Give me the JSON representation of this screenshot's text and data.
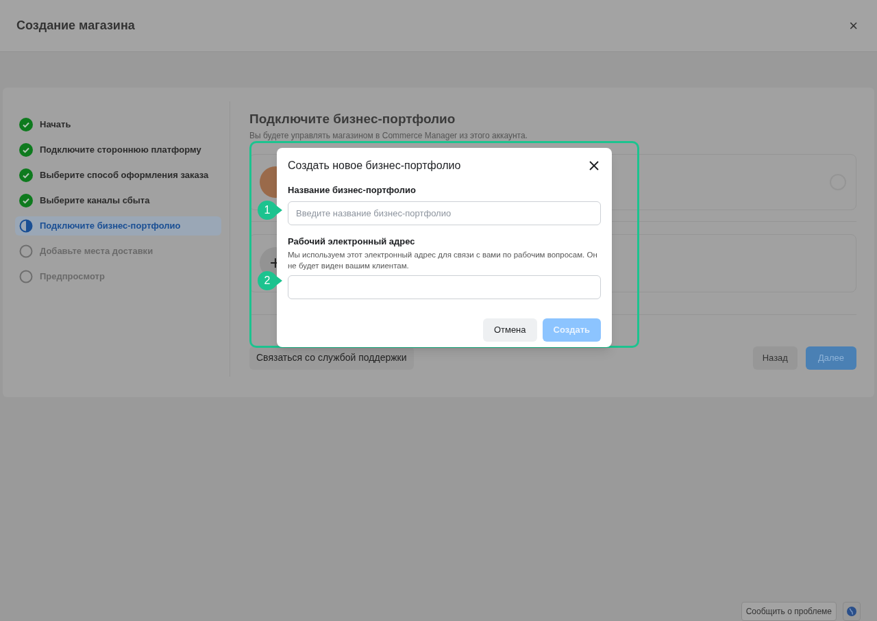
{
  "window": {
    "title": "Создание магазина",
    "close": "×"
  },
  "steps": [
    {
      "label": "Начать",
      "kind": "done",
      "selected": false
    },
    {
      "label": "Подключите стороннюю платформу",
      "kind": "done",
      "selected": false
    },
    {
      "label": "Выберите способ оформления заказа",
      "kind": "done",
      "selected": false
    },
    {
      "label": "Выберите каналы сбыта",
      "kind": "done",
      "selected": false
    },
    {
      "label": "Подключите бизнес-портфолио",
      "kind": "current",
      "selected": true
    },
    {
      "label": "Добавьте места доставки",
      "kind": "pending",
      "selected": false
    },
    {
      "label": "Предпросмотр",
      "kind": "pending",
      "selected": false
    }
  ],
  "main": {
    "title": "Подключите бизнес-портфолио",
    "subtitle": "Вы будете управлять магазином в Commerce Manager из этого аккаунта.",
    "account_selected": false,
    "add_symbol": "+",
    "support_button": "Связаться со службой поддержки",
    "back_button": "Назад",
    "next_button": "Далее"
  },
  "dialog": {
    "title": "Создать новое бизнес-портфолио",
    "fields": [
      {
        "label": "Название бизнес-портфолио",
        "placeholder": "Введите название бизнес-портфолио",
        "marker": "1"
      },
      {
        "label": "Рабочий электронный адрес",
        "help": "Мы используем этот электронный адрес для связи с вами по рабочим вопросам. Он не будет виден вашим клиентам.",
        "marker": "2"
      }
    ],
    "cancel_button": "Отмена",
    "create_button": {
      "label": "Создать",
      "disabled": true
    }
  },
  "footer": {
    "report_button": "Сообщить о проблеме"
  }
}
